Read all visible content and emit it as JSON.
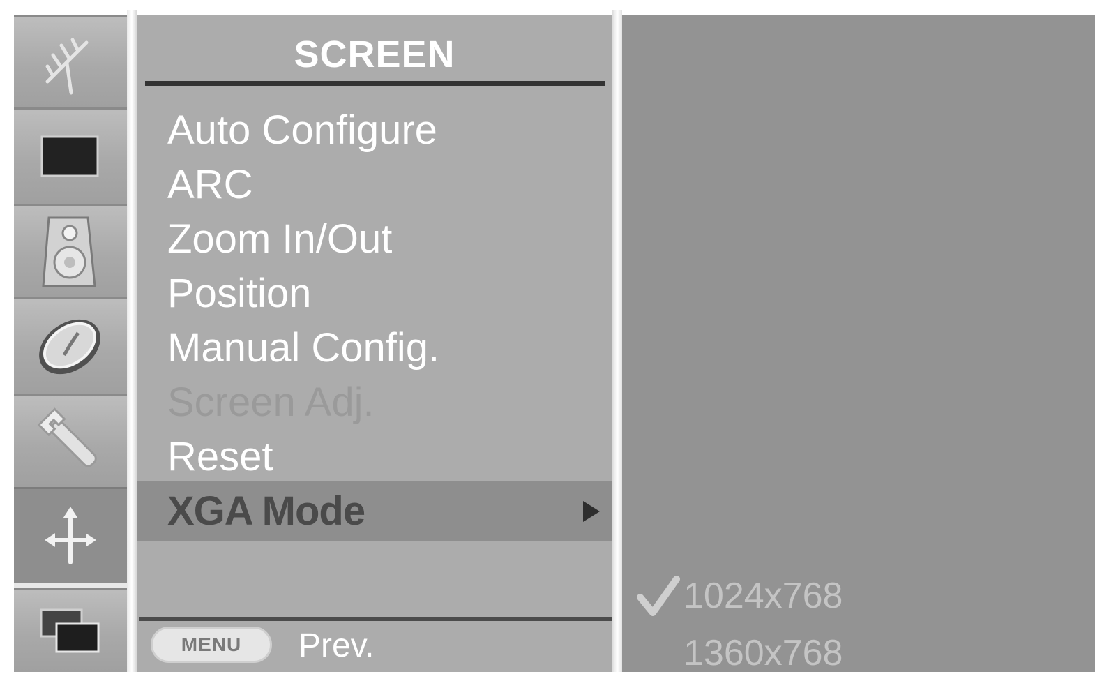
{
  "menu": {
    "title": "SCREEN",
    "items": [
      {
        "label": "Auto Configure",
        "state": "normal"
      },
      {
        "label": "ARC",
        "state": "normal"
      },
      {
        "label": "Zoom In/Out",
        "state": "normal"
      },
      {
        "label": "Position",
        "state": "normal"
      },
      {
        "label": "Manual Config.",
        "state": "normal"
      },
      {
        "label": "Screen Adj.",
        "state": "disabled"
      },
      {
        "label": "Reset",
        "state": "normal"
      },
      {
        "label": "XGA Mode",
        "state": "highlighted"
      }
    ]
  },
  "footer": {
    "menu_button_label": "MENU",
    "prev_label": "Prev."
  },
  "submenu": {
    "options": [
      {
        "label": "1024x768",
        "selected": true
      },
      {
        "label": "1360x768",
        "selected": false
      }
    ]
  },
  "icons": [
    {
      "name": "setup-antenna-icon"
    },
    {
      "name": "picture-icon"
    },
    {
      "name": "sound-speaker-icon"
    },
    {
      "name": "time-clock-icon"
    },
    {
      "name": "option-wrench-icon"
    },
    {
      "name": "screen-icon",
      "selected": true
    },
    {
      "name": "pip-icon"
    }
  ],
  "colors": {
    "menu_panel": "#acacac",
    "submenu_panel": "#939393",
    "highlight_row": "#8e8e8e",
    "text": "#ffffff",
    "disabled_text": "#9a9a9a"
  }
}
